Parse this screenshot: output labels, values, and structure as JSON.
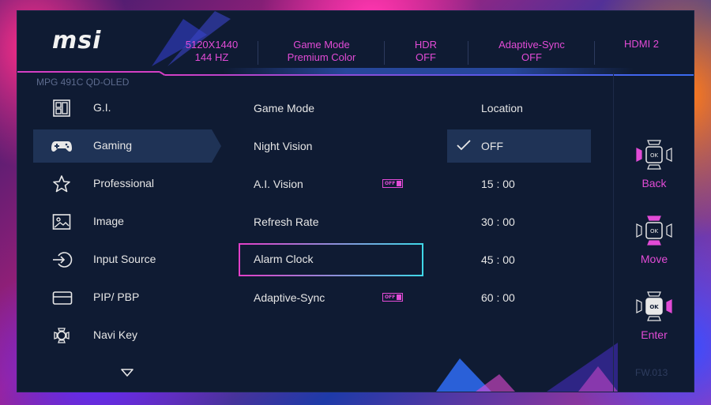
{
  "brand": "msi",
  "model": "MPG 491C QD-OLED",
  "status_bar": [
    {
      "line1": "5120X1440",
      "line2": "144 HZ"
    },
    {
      "line1": "Game Mode",
      "line2": "Premium Color"
    },
    {
      "line1": "HDR",
      "line2": "OFF"
    },
    {
      "line1": "Adaptive-Sync",
      "line2": "OFF"
    },
    {
      "line1": "HDMI 2",
      "line2": ""
    }
  ],
  "sidebar": {
    "items": [
      {
        "label": "G.I.",
        "icon": "gi-icon"
      },
      {
        "label": "Gaming",
        "icon": "gamepad-icon",
        "active": true
      },
      {
        "label": "Professional",
        "icon": "star-icon"
      },
      {
        "label": "Image",
        "icon": "image-icon"
      },
      {
        "label": "Input Source",
        "icon": "input-source-icon"
      },
      {
        "label": "PIP/ PBP",
        "icon": "pip-icon"
      },
      {
        "label": "Navi Key",
        "icon": "navi-key-icon"
      }
    ]
  },
  "submenu": {
    "items": [
      {
        "label": "Game Mode"
      },
      {
        "label": "Night Vision"
      },
      {
        "label": "A.I. Vision",
        "badge": "OFF"
      },
      {
        "label": "Refresh Rate"
      },
      {
        "label": "Alarm Clock",
        "selected": true
      },
      {
        "label": "Adaptive-Sync",
        "badge": "OFF"
      }
    ]
  },
  "options": {
    "items": [
      {
        "label": "Location"
      },
      {
        "label": "OFF",
        "checked": true
      },
      {
        "label": "15 : 00"
      },
      {
        "label": "30 : 00"
      },
      {
        "label": "45 : 00"
      },
      {
        "label": "60 : 00"
      }
    ]
  },
  "nav": {
    "back_label": "Back",
    "move_label": "Move",
    "enter_label": "Enter"
  },
  "firmware": "FW.013",
  "colors": {
    "accent": "#e24bd6",
    "panel": "#0f1b33",
    "highlight": "#1f3356",
    "text": "#e6e6e6"
  }
}
